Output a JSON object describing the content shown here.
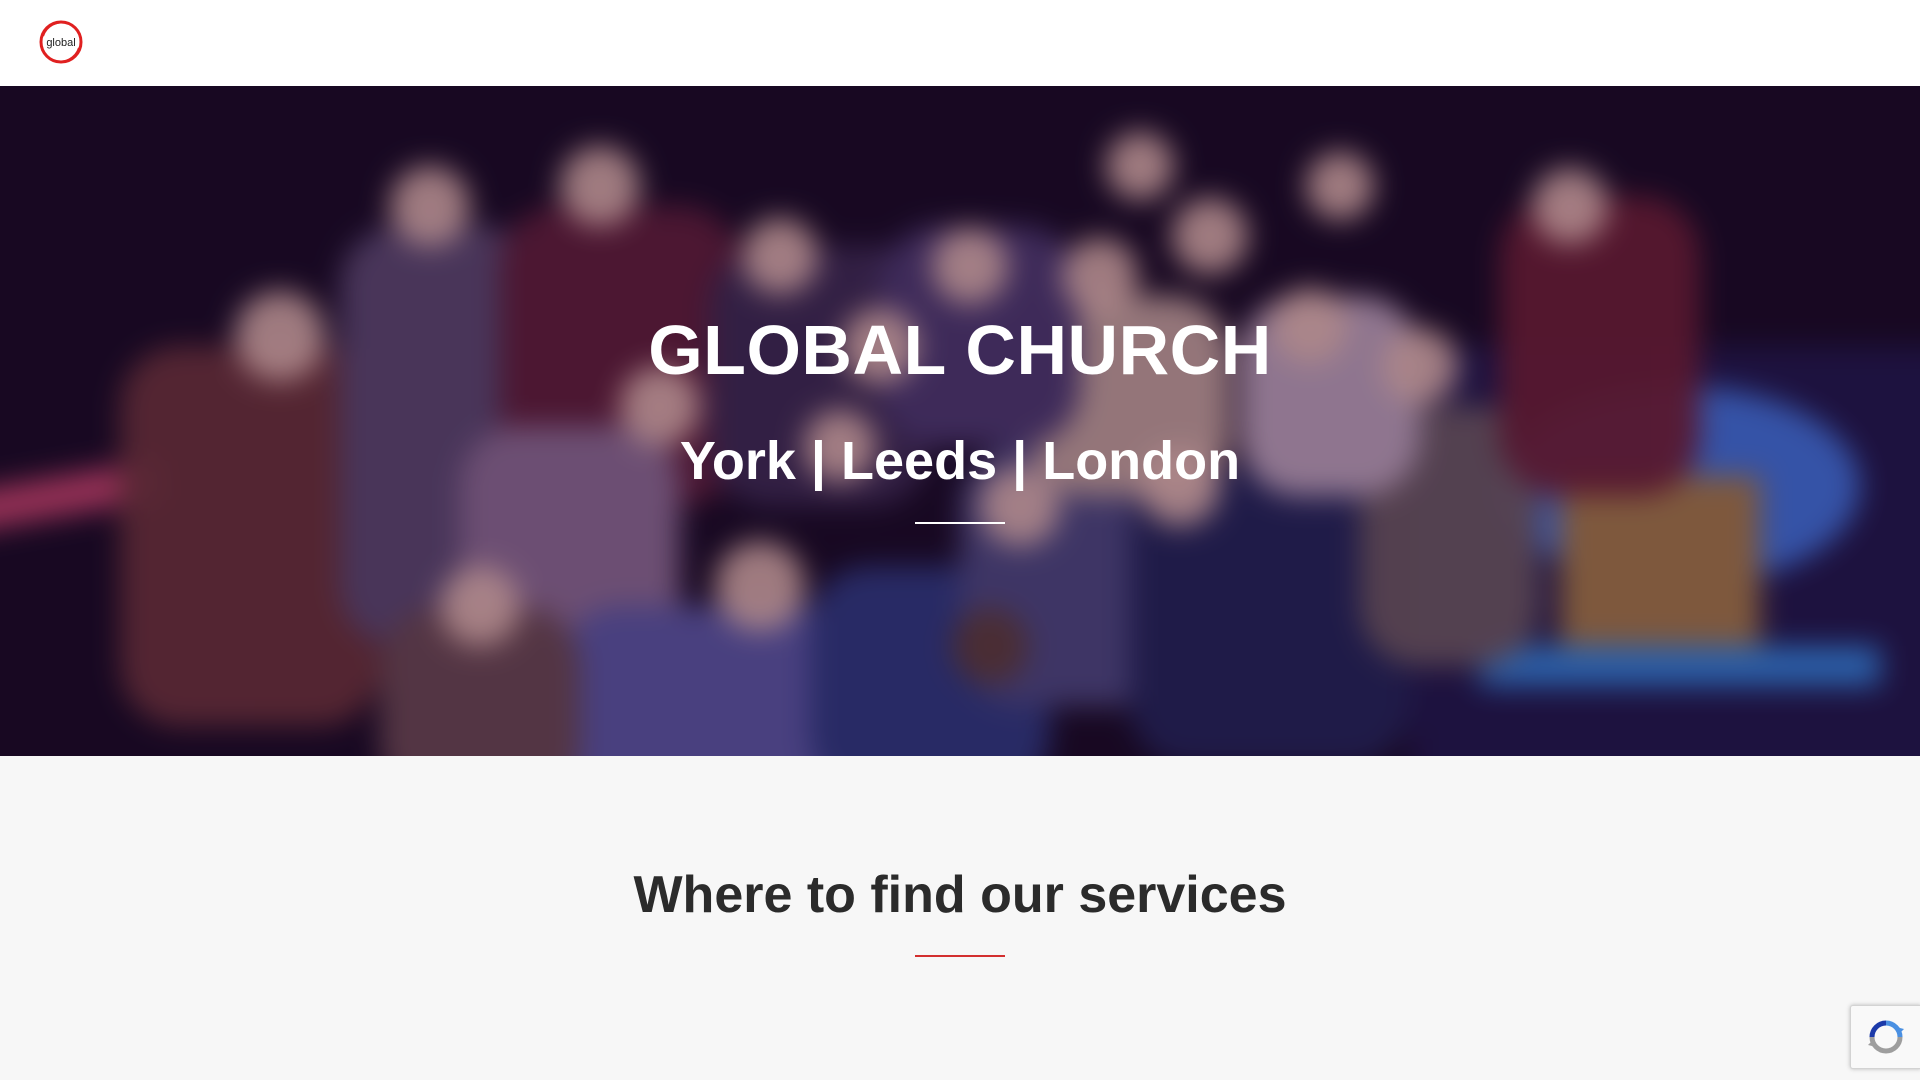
{
  "header": {
    "logo_text": "global",
    "logo_icon": "global-logo-icon"
  },
  "hero": {
    "title": "GLOBAL CHURCH",
    "subtitle": "York | Leeds | London",
    "photo": "group-photo-image"
  },
  "services": {
    "title": "Where to find our services"
  },
  "recaptcha": {
    "icon": "recaptcha-icon"
  },
  "colors": {
    "accent": "#d32f2f",
    "header_bg": "#ffffff",
    "section_bg": "#f7f7f7",
    "heading_text": "#2b2b2b",
    "hero_text": "#ffffff"
  }
}
